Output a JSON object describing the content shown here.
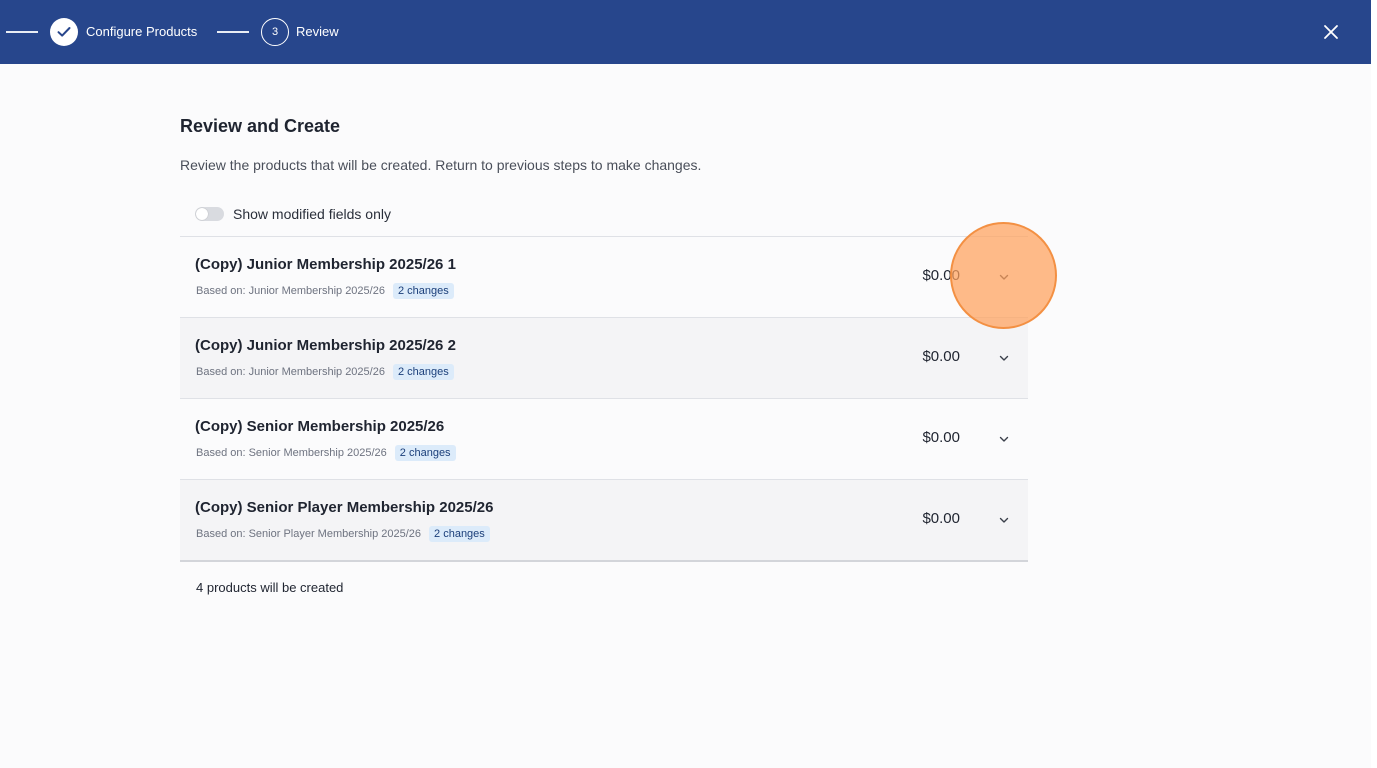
{
  "header": {
    "steps": [
      {
        "label": "Configure Products",
        "state": "complete"
      },
      {
        "label": "Review",
        "number": "3",
        "state": "current"
      }
    ],
    "close_icon": "close-icon"
  },
  "main": {
    "title": "Review and Create",
    "subtitle": "Review the products that will be created. Return to previous steps to make changes.",
    "toggle": {
      "label": "Show modified fields only",
      "checked": false
    },
    "products": [
      {
        "name": "(Copy) Junior Membership 2025/26 1",
        "based_on": "Based on: Junior Membership 2025/26",
        "badge": "2 changes",
        "price": "$0.00"
      },
      {
        "name": "(Copy) Junior Membership 2025/26 2",
        "based_on": "Based on: Junior Membership 2025/26",
        "badge": "2 changes",
        "price": "$0.00"
      },
      {
        "name": "(Copy) Senior Membership 2025/26",
        "based_on": "Based on: Senior Membership 2025/26",
        "badge": "2 changes",
        "price": "$0.00"
      },
      {
        "name": "(Copy) Senior Player Membership 2025/26",
        "based_on": "Based on: Senior Player Membership 2025/26",
        "badge": "2 changes",
        "price": "$0.00"
      }
    ],
    "footer": "4 products will be created"
  },
  "colors": {
    "header_bg": "#27468c",
    "badge_bg": "#dcebfa",
    "badge_text": "#1b3f7a",
    "click_marker": "#ffa15b"
  }
}
